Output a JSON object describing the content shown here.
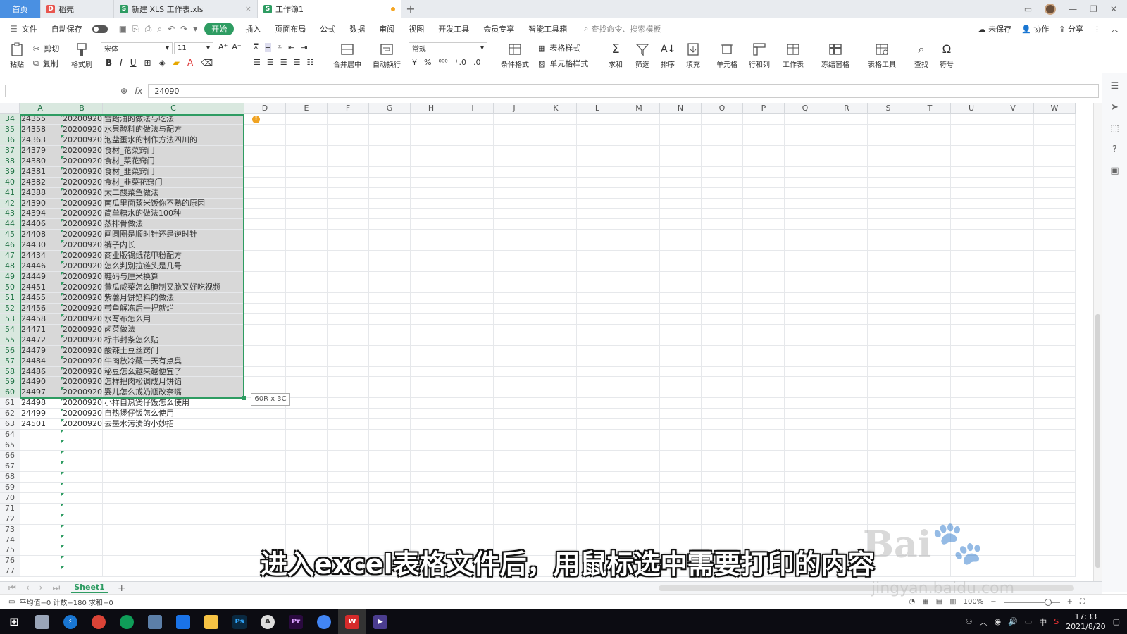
{
  "tabs": {
    "home": "首页",
    "tab1": "稻壳",
    "tab2": "新建 XLS 工作表.xls",
    "tab3": "工作簿1",
    "add": "+"
  },
  "menu": {
    "file": "文件",
    "autosave": "自动保存",
    "items": [
      "开始",
      "插入",
      "页面布局",
      "公式",
      "数据",
      "审阅",
      "视图",
      "开发工具",
      "会员专享",
      "智能工具箱"
    ],
    "search": "查找命令、搜索模板",
    "unsaved": "未保存",
    "collab": "协作",
    "share": "分享"
  },
  "ribbon": {
    "paste": "粘贴",
    "cut": "剪切",
    "copy": "复制",
    "format_painter": "格式刷",
    "font_name": "宋体",
    "font_size": "11",
    "merge": "合并居中",
    "wrap": "自动换行",
    "number_format": "常规",
    "table_style": "表格样式",
    "cond_format": "条件格式",
    "cell_style": "单元格样式",
    "sum": "求和",
    "filter": "筛选",
    "sort": "排序",
    "fill": "填充",
    "cell": "单元格",
    "rowcol": "行和列",
    "sheet": "工作表",
    "freeze": "冻结窗格",
    "table_tools": "表格工具",
    "find": "查找",
    "symbol": "符号"
  },
  "formula": {
    "fx": "fx",
    "value": "24090"
  },
  "columns": [
    "A",
    "B",
    "C",
    "D",
    "E",
    "F",
    "G",
    "H",
    "I",
    "J",
    "K",
    "L",
    "M",
    "N",
    "O",
    "P",
    "Q",
    "R",
    "S",
    "T",
    "U",
    "V",
    "W"
  ],
  "rows": [
    {
      "n": "34",
      "a": "24355",
      "b": "20200920",
      "c": "雪蛤油的做法与吃法"
    },
    {
      "n": "35",
      "a": "24358",
      "b": "20200920",
      "c": "水果酸料的做法与配方"
    },
    {
      "n": "36",
      "a": "24363",
      "b": "20200920",
      "c": "泡盐蛋水的制作方法四川的"
    },
    {
      "n": "37",
      "a": "24379",
      "b": "20200920",
      "c": "食材_花菜窍门"
    },
    {
      "n": "38",
      "a": "24380",
      "b": "20200920",
      "c": "食材_菜花窍门"
    },
    {
      "n": "39",
      "a": "24381",
      "b": "20200920",
      "c": "食材_韭菜窍门"
    },
    {
      "n": "40",
      "a": "24382",
      "b": "20200920",
      "c": "食材_韭菜花窍门"
    },
    {
      "n": "41",
      "a": "24388",
      "b": "20200920",
      "c": "太二酸菜鱼做法"
    },
    {
      "n": "42",
      "a": "24390",
      "b": "20200920",
      "c": "南瓜里面蒸米饭你不熟的原因"
    },
    {
      "n": "43",
      "a": "24394",
      "b": "20200920",
      "c": "简单糖水的做法100种"
    },
    {
      "n": "44",
      "a": "24406",
      "b": "20200920",
      "c": "蒸排骨做法"
    },
    {
      "n": "45",
      "a": "24408",
      "b": "20200920",
      "c": "画圆圈是顺时针还是逆时针"
    },
    {
      "n": "46",
      "a": "24430",
      "b": "20200920",
      "c": "裤子内长"
    },
    {
      "n": "47",
      "a": "24434",
      "b": "20200920",
      "c": "商业版锡纸花甲粉配方"
    },
    {
      "n": "48",
      "a": "24446",
      "b": "20200920",
      "c": "怎么判别拉链头是几号"
    },
    {
      "n": "49",
      "a": "24449",
      "b": "20200920",
      "c": "鞋码与厘米换算"
    },
    {
      "n": "50",
      "a": "24451",
      "b": "20200920",
      "c": "黄瓜咸菜怎么腌制又脆又好吃视频"
    },
    {
      "n": "51",
      "a": "24455",
      "b": "20200920",
      "c": "紫薯月饼馅料的做法"
    },
    {
      "n": "52",
      "a": "24456",
      "b": "20200920",
      "c": "带鱼解冻后一捏就烂"
    },
    {
      "n": "53",
      "a": "24458",
      "b": "20200920",
      "c": "水写布怎么用"
    },
    {
      "n": "54",
      "a": "24471",
      "b": "20200920",
      "c": "卤菜做法"
    },
    {
      "n": "55",
      "a": "24472",
      "b": "20200920",
      "c": "标书封条怎么贴"
    },
    {
      "n": "56",
      "a": "24479",
      "b": "20200920",
      "c": "酸辣土豆丝窍门"
    },
    {
      "n": "57",
      "a": "24484",
      "b": "20200920",
      "c": "牛肉放冷藏一天有点臭"
    },
    {
      "n": "58",
      "a": "24486",
      "b": "20200920",
      "c": "秘豆怎么越来越便宜了"
    },
    {
      "n": "59",
      "a": "24490",
      "b": "20200920",
      "c": "怎样把肉松调成月饼馅"
    },
    {
      "n": "60",
      "a": "24497",
      "b": "20200920",
      "c": "婴儿怎么戒奶瓶改奈嘴"
    },
    {
      "n": "61",
      "a": "24498",
      "b": "20200920",
      "c": "小样自热煲仔饭怎么使用"
    },
    {
      "n": "62",
      "a": "24499",
      "b": "20200920",
      "c": "自热煲仔饭怎么使用"
    },
    {
      "n": "63",
      "a": "24501",
      "b": "20200920",
      "c": "去墨水污渍的小妙招"
    },
    {
      "n": "64",
      "a": "",
      "b": "",
      "c": ""
    },
    {
      "n": "65",
      "a": "",
      "b": "",
      "c": ""
    },
    {
      "n": "66",
      "a": "",
      "b": "",
      "c": ""
    },
    {
      "n": "67",
      "a": "",
      "b": "",
      "c": ""
    },
    {
      "n": "68",
      "a": "",
      "b": "",
      "c": ""
    },
    {
      "n": "69",
      "a": "",
      "b": "",
      "c": ""
    },
    {
      "n": "70",
      "a": "",
      "b": "",
      "c": ""
    },
    {
      "n": "71",
      "a": "",
      "b": "",
      "c": ""
    },
    {
      "n": "72",
      "a": "",
      "b": "",
      "c": ""
    },
    {
      "n": "73",
      "a": "",
      "b": "",
      "c": ""
    },
    {
      "n": "74",
      "a": "",
      "b": "",
      "c": ""
    },
    {
      "n": "75",
      "a": "",
      "b": "",
      "c": ""
    },
    {
      "n": "76",
      "a": "",
      "b": "",
      "c": ""
    },
    {
      "n": "77",
      "a": "",
      "b": "",
      "c": ""
    }
  ],
  "selection_tip": "60R x 3C",
  "sheet": {
    "name": "Sheet1",
    "add": "+"
  },
  "status": {
    "text": "平均值=0  计数=180  求和=0",
    "zoom": "100%"
  },
  "subtitle": "进入excel表格文件后，用鼠标选中需要打印的内容",
  "watermark": {
    "brand": "Bai",
    "url": "jingyan.baidu.com"
  },
  "taskbar": {
    "time": "17:33",
    "date": "2021/8/20",
    "ime": "中"
  },
  "colors": {
    "accent": "#2e9c62",
    "home_tab": "#4a90e2",
    "selection_fill": "#d8d8d8"
  }
}
